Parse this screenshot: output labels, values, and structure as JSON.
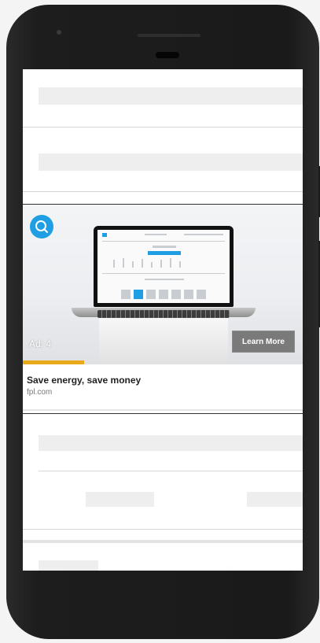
{
  "ad": {
    "logo_icon": "blue-circle-logo-icon",
    "counter_label": "Ad: 4",
    "cta_label": "Learn More",
    "headline": "Save energy, save money",
    "domain": "fpl.com",
    "progress_fraction": 0.22,
    "progress_color": "#e8a91b"
  },
  "colors": {
    "screen_bg": "#ffffff",
    "placeholder": "#eeeeee",
    "phone_body": "#1a1a1a",
    "brand_blue": "#1f9ee3"
  }
}
